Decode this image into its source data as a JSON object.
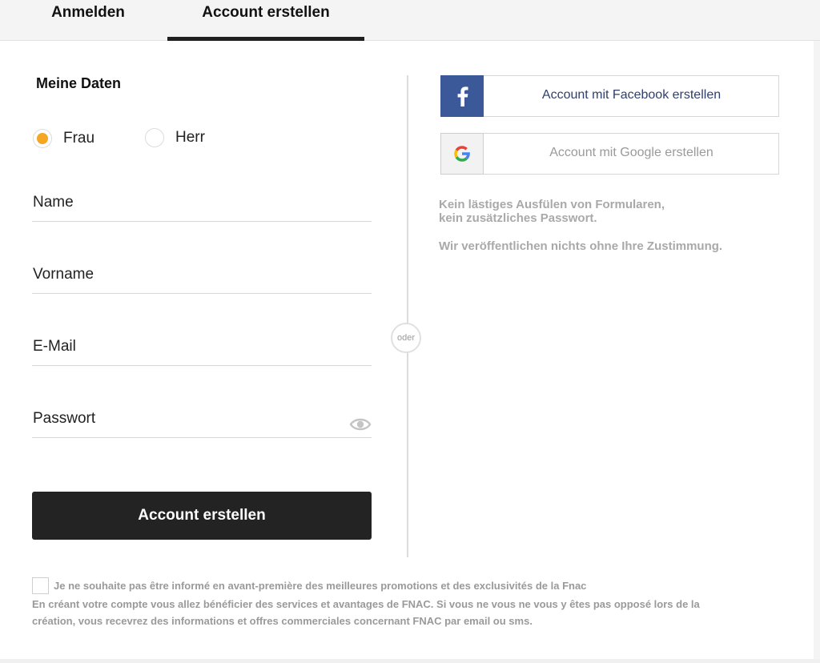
{
  "tabs": {
    "login": "Anmelden",
    "create": "Account erstellen"
  },
  "form": {
    "title": "Meine Daten",
    "radio_frau": "Frau",
    "radio_herr": "Herr",
    "selected_salutation": "Frau",
    "name_placeholder": "Name",
    "vorname_placeholder": "Vorname",
    "email_placeholder": "E-Mail",
    "password_placeholder": "Passwort",
    "submit_label": "Account erstellen"
  },
  "divider": {
    "label": "oder"
  },
  "social": {
    "facebook_label": "Account mit Facebook erstellen",
    "google_label": "Account mit Google erstellen",
    "info_line1": "Kein lästiges Ausfülen von Formularen,",
    "info_line2": "kein zusätzliches Passwort.",
    "info_line3": "Wir veröffentlichen nichts ohne Ihre Zustimmung.",
    "facebook_color": "#3b5998"
  },
  "legal": {
    "optout_label": "Je ne souhaite pas être informé en avant-première des meilleures promotions et des exclusivités de la Fnac",
    "optout_checked": false,
    "text_line1": "En créant votre compte vous allez bénéficier des services et avantages de FNAC. Si vous ne vous ne vous y êtes pas opposé lors de la",
    "text_line2": "création, vous recevrez des informations et offres commerciales concernant FNAC par email ou sms."
  },
  "colors": {
    "accent_radio": "#f5a623",
    "button_dark": "#232323"
  }
}
